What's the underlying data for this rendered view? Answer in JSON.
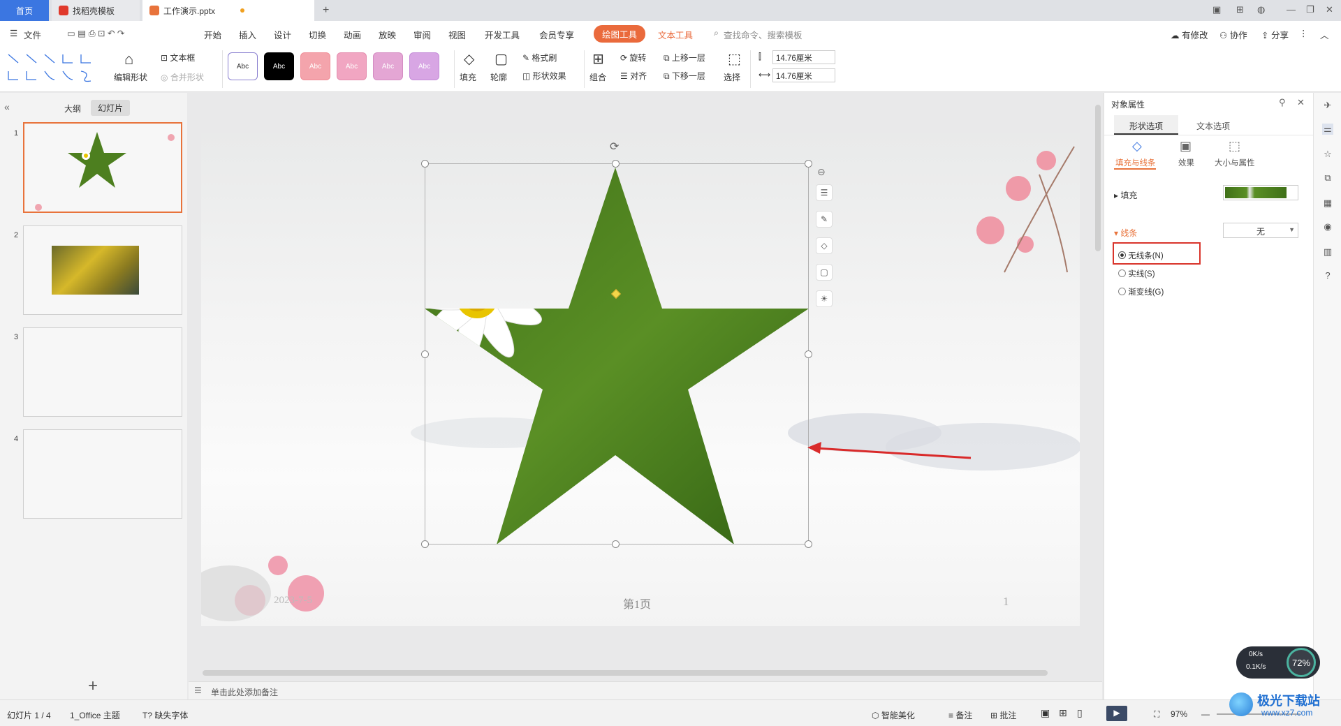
{
  "tabs": {
    "home": "首页",
    "template": "找稻壳模板",
    "document": "工作演示.pptx"
  },
  "menubar": {
    "file": "文件",
    "items": [
      "开始",
      "插入",
      "设计",
      "切换",
      "动画",
      "放映",
      "审阅",
      "视图",
      "开发工具",
      "会员专享"
    ],
    "drawing_tools": "绘图工具",
    "text_tools": "文本工具",
    "search_placeholder": "查找命令、搜索模板",
    "modified": "有修改",
    "collab": "协作",
    "share": "分享"
  },
  "ribbon": {
    "edit_shape": "编辑形状",
    "textbox": "文本框",
    "merge_shape": "合并形状",
    "style_label": "Abc",
    "fill": "填充",
    "outline": "轮廓",
    "format_brush": "格式刷",
    "shape_effect": "形状效果",
    "group": "组合",
    "rotate": "旋转",
    "align": "对齐",
    "bring_forward": "上移一层",
    "send_backward": "下移一层",
    "select": "选择",
    "height": "14.76厘米",
    "width": "14.76厘米"
  },
  "leftpanel": {
    "outline_tab": "大纲",
    "slides_tab": "幻灯片",
    "slide_numbers": [
      "1",
      "2",
      "3",
      "4"
    ],
    "add_slide": "+"
  },
  "slide": {
    "date": "2023-7-5",
    "footer": "第1页",
    "page_num": "1"
  },
  "notes": {
    "placeholder": "单击此处添加备注"
  },
  "rightpanel": {
    "title": "对象属性",
    "tab_shape": "形状选项",
    "tab_text": "文本选项",
    "sub_fill_line": "填充与线条",
    "sub_effect": "效果",
    "sub_size": "大小与属性",
    "fill_label": "填充",
    "line_label": "线条",
    "line_value": "无",
    "opt_none": "无线条(N)",
    "opt_solid": "实线(S)",
    "opt_gradient": "渐变线(G)"
  },
  "network": {
    "up": "0K/s",
    "down": "0.1K/s",
    "percent": "72%"
  },
  "statusbar": {
    "slide_info": "幻灯片 1 / 4",
    "theme": "1_Office 主题",
    "missing_font": "缺失字体",
    "smart_beauty": "智能美化",
    "notes": "备注",
    "comments": "批注",
    "zoom": "97%"
  },
  "watermark": {
    "name": "极光下载站",
    "url": "www.xz7.com"
  },
  "colors": {
    "accent": "#3b76e1",
    "drawing_tab": "#ea6a3c",
    "star_green": "#4d7f1f",
    "highlight_box": "#d9342b",
    "arrow": "#d92a2a"
  }
}
